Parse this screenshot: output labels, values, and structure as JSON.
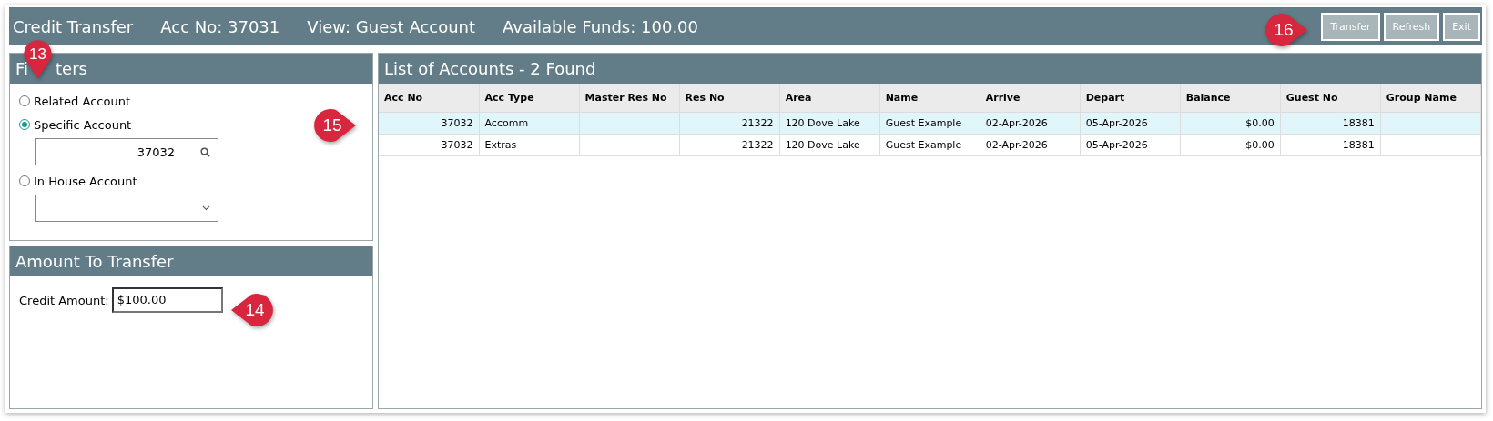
{
  "window": {
    "title": "Credit Transfer",
    "acc_no": "Acc No: 37031",
    "view": "View: Guest Account",
    "funds": "Available Funds: 100.00"
  },
  "buttons": [
    {
      "label": "Transfer"
    },
    {
      "label": "Refresh"
    },
    {
      "label": "Exit"
    }
  ],
  "filters": {
    "title_parts": [
      "Fi",
      "ters"
    ],
    "options": [
      {
        "label": "Related Account",
        "selected": false,
        "kind": "plain"
      },
      {
        "label": "Specific Account",
        "selected": true,
        "kind": "search",
        "value": "37032"
      },
      {
        "label": "In House Account",
        "selected": false,
        "kind": "dropdown"
      }
    ]
  },
  "amount": {
    "title": "Amount To Transfer",
    "label": "Credit Amount:",
    "value": "$100.00"
  },
  "table": {
    "title": "List of Accounts - 2 Found",
    "columns": [
      {
        "label": "Acc No",
        "kind": "number"
      },
      {
        "label": "Acc Type",
        "kind": "text"
      },
      {
        "label": "Master Res No",
        "kind": "number"
      },
      {
        "label": "Res No",
        "kind": "number"
      },
      {
        "label": "Area",
        "kind": "text"
      },
      {
        "label": "Name",
        "kind": "text"
      },
      {
        "label": "Arrive",
        "kind": "text"
      },
      {
        "label": "Depart",
        "kind": "text"
      },
      {
        "label": "Balance",
        "kind": "number"
      },
      {
        "label": "Guest No",
        "kind": "number"
      },
      {
        "label": "Group Name",
        "kind": "text"
      }
    ],
    "rows": [
      {
        "selected": true,
        "cells": [
          "37032",
          "Accomm",
          "",
          "21322",
          "120 Dove Lake",
          "Guest Example",
          "02-Apr-2026",
          "05-Apr-2026",
          "$0.00",
          "18381",
          ""
        ]
      },
      {
        "selected": false,
        "cells": [
          "37032",
          "Extras",
          "",
          "21322",
          "120 Dove Lake",
          "Guest Example",
          "02-Apr-2026",
          "05-Apr-2026",
          "$0.00",
          "18381",
          ""
        ]
      }
    ]
  },
  "callouts": [
    {
      "label": "13"
    },
    {
      "label": "14"
    },
    {
      "label": "15"
    },
    {
      "label": "16"
    }
  ]
}
